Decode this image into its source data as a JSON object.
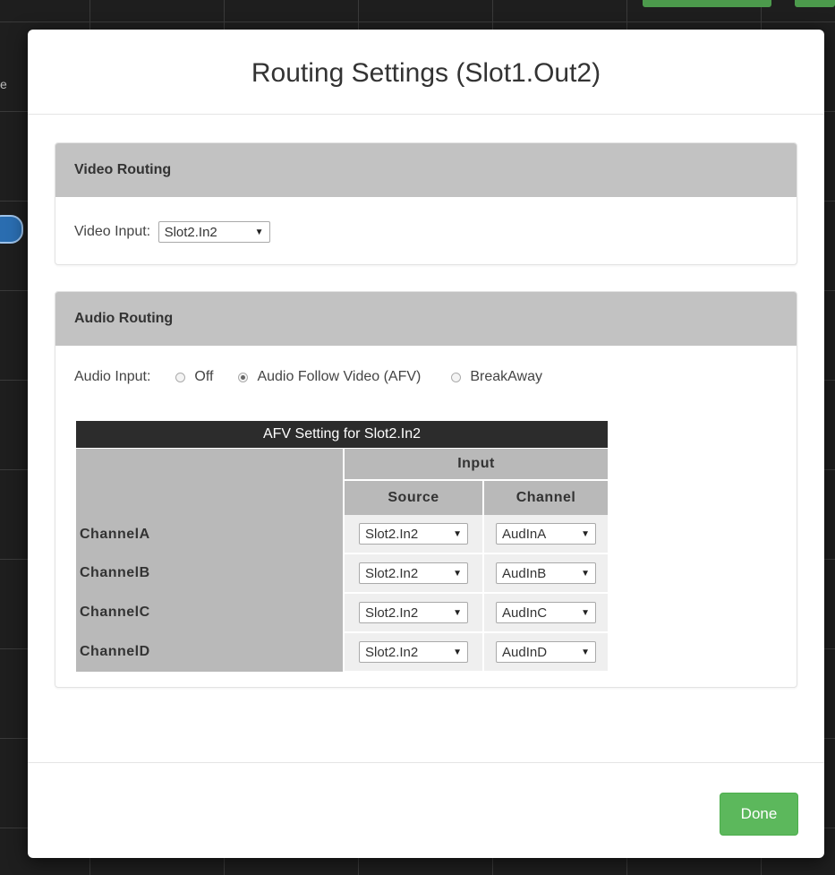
{
  "background": {
    "edge_text": "e"
  },
  "modal": {
    "title": "Routing Settings (Slot1.Out2)",
    "video_routing": {
      "heading": "Video Routing",
      "input_label": "Video Input:",
      "input_value": "Slot2.In2"
    },
    "audio_routing": {
      "heading": "Audio Routing",
      "input_label": "Audio Input:",
      "options": [
        {
          "label": "Off",
          "checked": false
        },
        {
          "label": "Audio Follow Video (AFV)",
          "checked": true
        },
        {
          "label": "BreakAway",
          "checked": false
        }
      ],
      "afv_table": {
        "caption": "AFV Setting for Slot2.In2",
        "group_header": "Input",
        "source_header": "Source",
        "channel_header": "Channel",
        "rows": [
          {
            "label": "ChannelA",
            "source": "Slot2.In2",
            "channel": "AudInA"
          },
          {
            "label": "ChannelB",
            "source": "Slot2.In2",
            "channel": "AudInB"
          },
          {
            "label": "ChannelC",
            "source": "Slot2.In2",
            "channel": "AudInC"
          },
          {
            "label": "ChannelD",
            "source": "Slot2.In2",
            "channel": "AudInD"
          }
        ]
      }
    },
    "done_label": "Done"
  },
  "colors": {
    "done_button": "#5cb85c",
    "panel_heading": "#c2c2c2",
    "table_caption": "#2c2c2c"
  }
}
